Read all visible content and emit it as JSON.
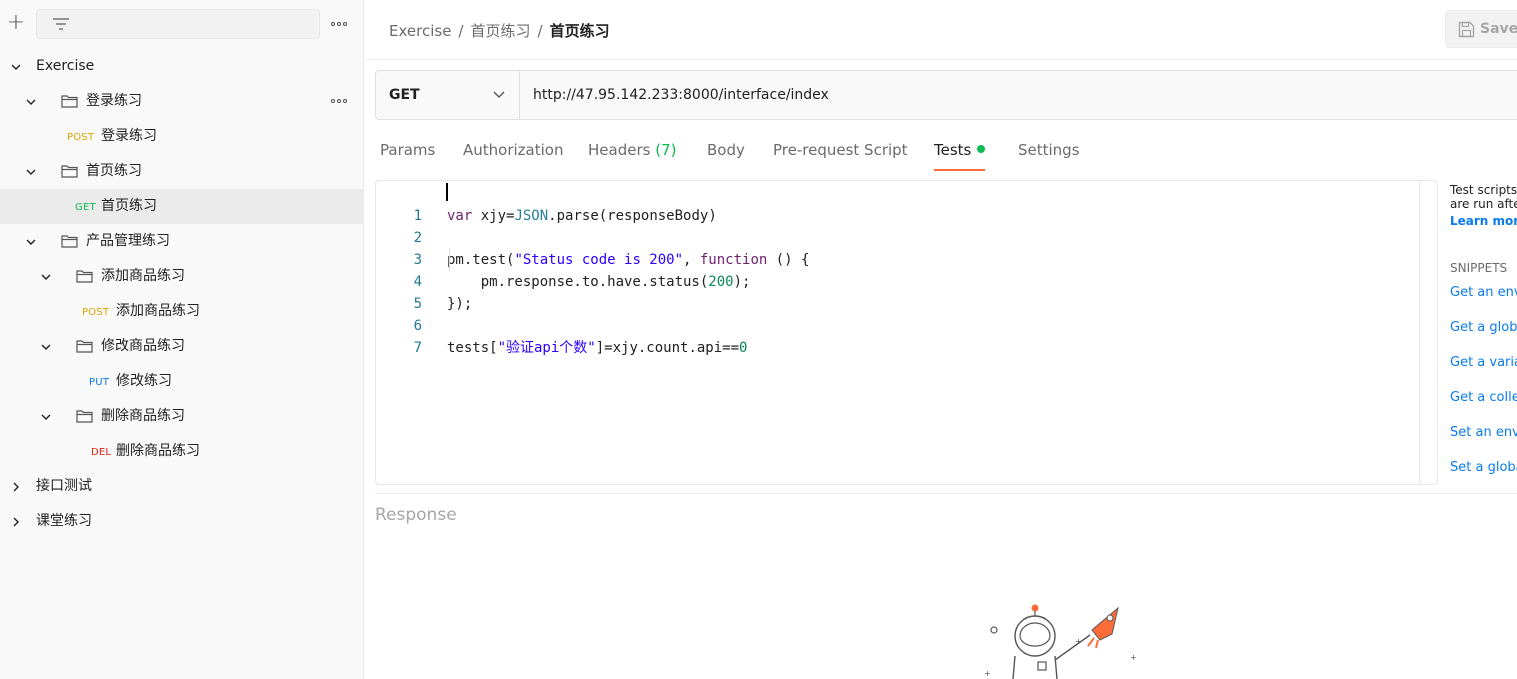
{
  "sidebar": {
    "items": [
      {
        "label": "Exercise"
      },
      {
        "label": "登录练习"
      },
      {
        "method": "POST",
        "label": "登录练习"
      },
      {
        "label": "首页练习"
      },
      {
        "method": "GET",
        "label": "首页练习"
      },
      {
        "label": "产品管理练习"
      },
      {
        "label": "添加商品练习"
      },
      {
        "method": "POST",
        "label": "添加商品练习"
      },
      {
        "label": "修改商品练习"
      },
      {
        "method": "PUT",
        "label": "修改练习"
      },
      {
        "label": "删除商品练习"
      },
      {
        "method": "DEL",
        "label": "删除商品练习"
      },
      {
        "label": "接口测试"
      },
      {
        "label": "课堂练习"
      }
    ]
  },
  "header": {
    "breadcrumb": [
      "Exercise",
      "首页练习",
      "首页练习"
    ],
    "separator": "/",
    "save_label": "Save"
  },
  "request": {
    "method": "GET",
    "url": "http://47.95.142.233:8000/interface/index"
  },
  "tabs": {
    "params": "Params",
    "authorization": "Authorization",
    "headers": "Headers",
    "headers_count": "(7)",
    "body": "Body",
    "prerequest": "Pre-request Script",
    "tests": "Tests",
    "settings": "Settings"
  },
  "editor": {
    "line_numbers": [
      "1",
      "2",
      "3",
      "4",
      "5",
      "6",
      "7"
    ]
  },
  "snippets": {
    "desc_line1": "Test scripts",
    "desc_line2": "are run afte",
    "learn_more": "Learn more",
    "title": "SNIPPETS",
    "items": [
      "Get an envi",
      "Get a globa",
      "Get a variab",
      "Get a collec",
      "Set an envi",
      "Set a globa"
    ]
  },
  "response": {
    "label": "Response"
  },
  "colors": {
    "accent": "#ff6c37",
    "post": "#d9a400",
    "get": "#0cbb52",
    "put": "#097bed",
    "del": "#eb2013",
    "link": "#097bed"
  }
}
